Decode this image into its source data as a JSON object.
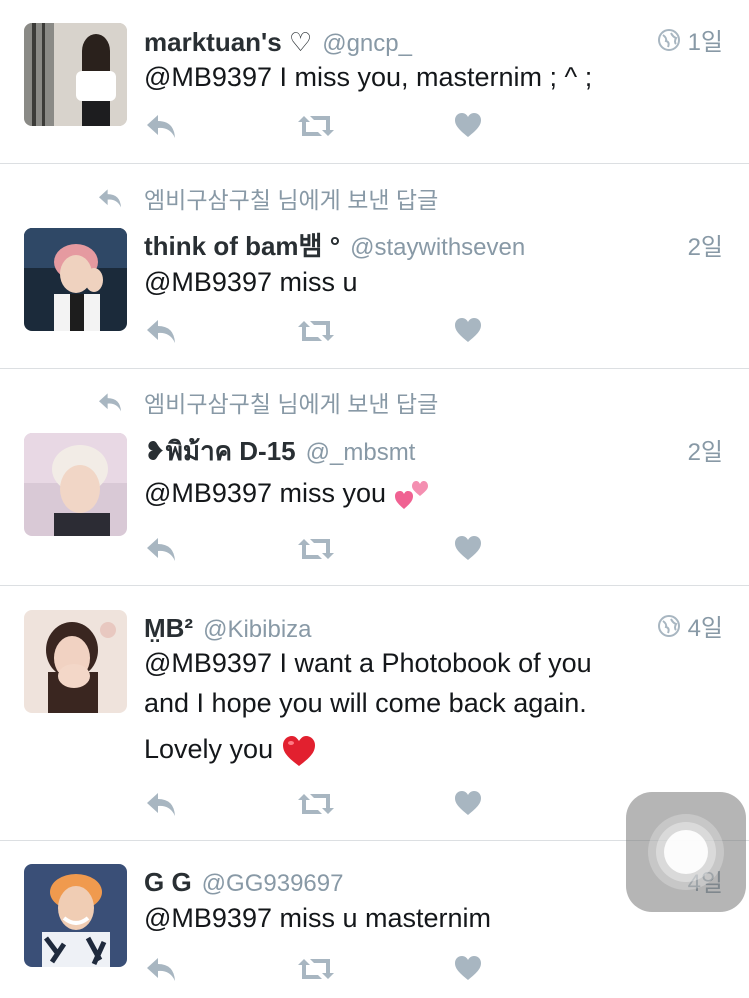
{
  "colors": {
    "meta": "#8899a6",
    "text": "#14171a",
    "heart": "#e0245e",
    "separator": "#dcdfe2"
  },
  "tweets": [
    {
      "reply_context": "",
      "name": "marktuan's ♡",
      "handle": "@gncp_",
      "time": "1일",
      "has_globe": true,
      "lines": [
        "@MB9397 I miss you, masternim ; ^ ;"
      ],
      "avatar_icon": "avatar-girl-white-shirt"
    },
    {
      "reply_context": "엠비구삼구칠 님에게 보낸 답글",
      "name": "think of bam뱀 °",
      "handle": "@staywithseven",
      "time": "2일",
      "has_globe": false,
      "lines": [
        "@MB9397 miss u"
      ],
      "avatar_icon": "avatar-pink-hair"
    },
    {
      "reply_context": "엠비구삼구칠 님에게 보낸 답글",
      "name": "❥พิม้าค D-15",
      "handle": "@_mbsmt",
      "time": "2일",
      "has_globe": false,
      "lines": [
        "@MB9397 miss you"
      ],
      "emoji": "two-hearts-emoji",
      "avatar_icon": "avatar-white-hair"
    },
    {
      "reply_context": "",
      "name": "M̤B²",
      "handle": "@Kibibiza",
      "time": "4일",
      "has_globe": true,
      "lines": [
        "@MB9397 I want a Photobook of you",
        "and I hope you will come back again.",
        "Lovely you"
      ],
      "emoji": "red-heart-emoji",
      "avatar_icon": "avatar-girl-hands"
    },
    {
      "reply_context": "",
      "name": "G G",
      "handle": "@GG939697",
      "time": "4일",
      "has_globe": false,
      "lines": [
        "@MB9397 miss u masternim"
      ],
      "avatar_icon": "avatar-orange-hair"
    }
  ]
}
